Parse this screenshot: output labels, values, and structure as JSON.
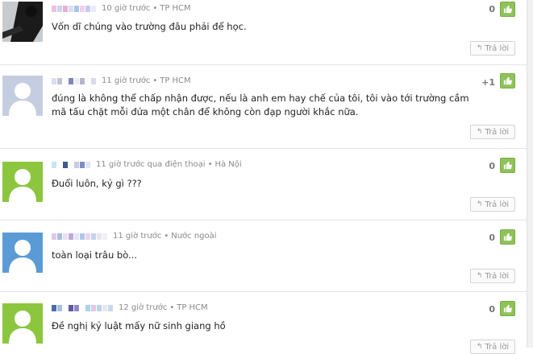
{
  "comments": [
    {
      "time": "10 giờ trước",
      "location": "TP HCM",
      "text": "Vốn dĩ chúng vào trường đâu phải để học.",
      "score": "0",
      "reply_label": "Trả lời",
      "avatar": "photo-avatar"
    },
    {
      "time": "11 giờ trước",
      "location": "TP HCM",
      "text": "đúng là không thể chấp nhận được, nếu là anh em hay chế của tôi, tôi vào tới trường cầm mã tấu chặt mỗi đứa một chân để không còn đạp người khắc nữa.",
      "score": "+1",
      "reply_label": "Trả lời",
      "avatar": "default-avatar-grey"
    },
    {
      "time": "11 giờ trước qua điện thoại",
      "location": "Hà Nội",
      "text": "Đuổi luôn, kỷ gì ???",
      "score": "0",
      "reply_label": "Trả lời",
      "avatar": "default-avatar-green"
    },
    {
      "time": "11 giờ trước",
      "location": "Nước ngoài",
      "text": "toàn loại trâu bò...",
      "score": "0",
      "reply_label": "Trả lời",
      "avatar": "default-avatar-blue"
    },
    {
      "time": "12 giờ trước",
      "location": "TP HCM",
      "text": "Đề nghị kỷ luật mấy nữ sinh giang hồ",
      "score": "0",
      "reply_label": "Trả lời",
      "avatar": "default-avatar-green"
    }
  ],
  "separator": "•",
  "colors": {
    "like_green": "#8fc35a",
    "avatar_grey": "#c5cde0",
    "avatar_green": "#8cc63f",
    "avatar_blue": "#5b9bd5"
  }
}
